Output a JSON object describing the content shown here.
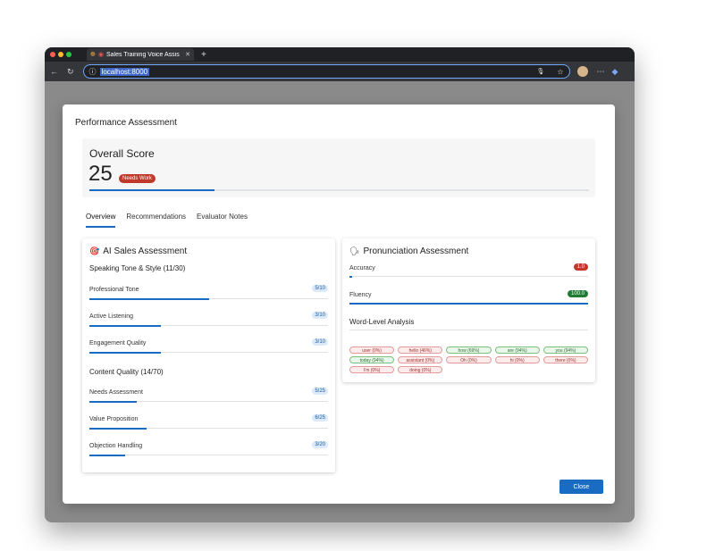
{
  "browser": {
    "tab_title": "Sales Training Voice Assis",
    "url": "localhost:8000",
    "colors": {
      "chrome_dark": "#202124",
      "chrome_toolbar": "#35363a",
      "url_highlight": "#3d66c5"
    }
  },
  "modal": {
    "title": "Performance Assessment",
    "overall": {
      "label": "Overall Score",
      "value": "25",
      "fraction": 0.25,
      "badge": "Needs Work",
      "badge_color": "#c0392b"
    },
    "tabs": [
      {
        "label": "Overview",
        "active": true
      },
      {
        "label": "Recommendations",
        "active": false
      },
      {
        "label": "Evaluator Notes",
        "active": false
      }
    ],
    "ai": {
      "icon": "target-icon",
      "title": "AI Sales Assessment",
      "tone_title": "Speaking Tone & Style (11/30)",
      "tone_items": [
        {
          "label": "Professional Tone",
          "score": "5/10",
          "fraction": 0.5
        },
        {
          "label": "Active Listening",
          "score": "3/10",
          "fraction": 0.3
        },
        {
          "label": "Engagement Quality",
          "score": "3/10",
          "fraction": 0.3
        }
      ],
      "content_title": "Content Quality (14/70)",
      "content_items": [
        {
          "label": "Needs Assessment",
          "score": "5/25",
          "fraction": 0.2
        },
        {
          "label": "Value Proposition",
          "score": "6/25",
          "fraction": 0.24
        },
        {
          "label": "Objection Handling",
          "score": "3/20",
          "fraction": 0.15
        }
      ]
    },
    "pron": {
      "icon": "speaking-head-icon",
      "title": "Pronunciation Assessment",
      "accuracy": {
        "label": "Accuracy",
        "value": "1.0",
        "fraction": 0.01,
        "color": "#c0392b"
      },
      "fluency": {
        "label": "Fluency",
        "value": "100.0",
        "fraction": 1.0,
        "color": "#1e7d32"
      },
      "word_title": "Word-Level Analysis",
      "words": [
        {
          "text": "user (0%)",
          "status": "bad"
        },
        {
          "text": "hello (46%)",
          "status": "bad"
        },
        {
          "text": "how (69%)",
          "status": "good"
        },
        {
          "text": "are (94%)",
          "status": "good"
        },
        {
          "text": "you (94%)",
          "status": "good"
        },
        {
          "text": "today (94%)",
          "status": "good"
        },
        {
          "text": "assistant (0%)",
          "status": "bad"
        },
        {
          "text": "Oh (0%)",
          "status": "bad"
        },
        {
          "text": "hi (0%)",
          "status": "bad"
        },
        {
          "text": "there (0%)",
          "status": "bad"
        },
        {
          "text": "I'm (0%)",
          "status": "bad"
        },
        {
          "text": "doing (0%)",
          "status": "bad"
        }
      ]
    },
    "close_label": "Close"
  }
}
